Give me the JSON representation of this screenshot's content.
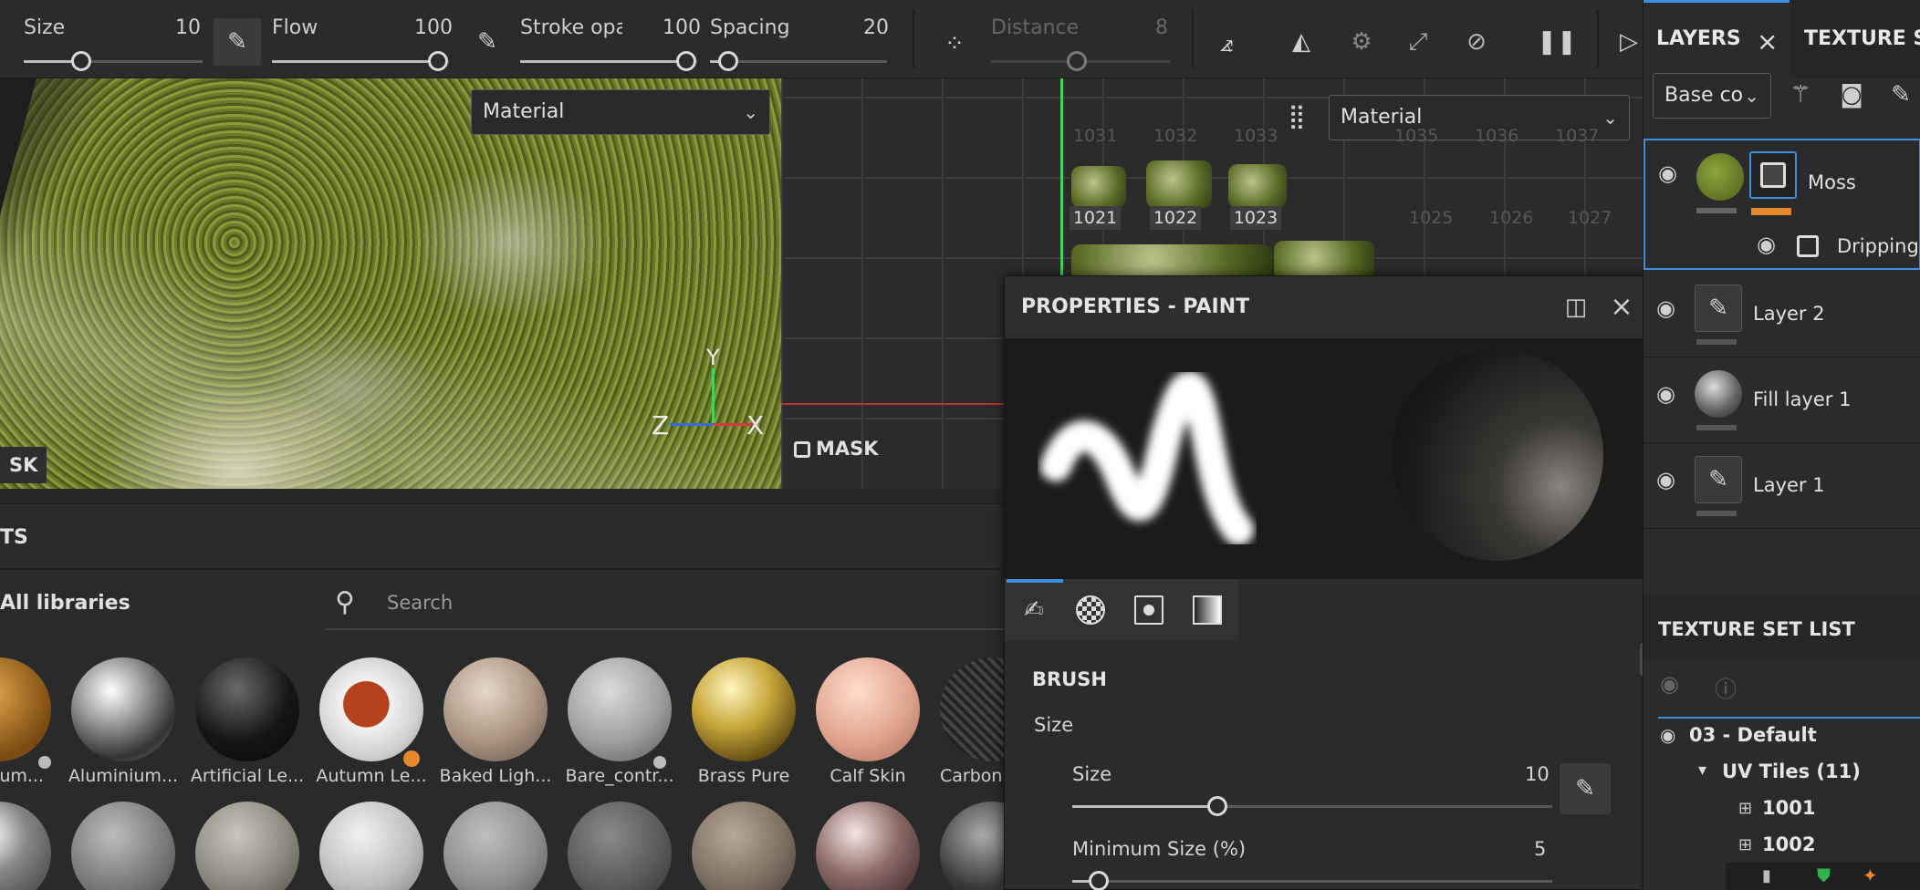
{
  "toolbar": {
    "size_label": "Size",
    "size_value": "10",
    "flow_label": "Flow",
    "flow_value": "100",
    "stroke_label": "Stroke opac",
    "stroke_value": "100",
    "spacing_label": "Spacing",
    "spacing_value": "20",
    "distance_label": "Distance",
    "distance_value": "8"
  },
  "viewport3d": {
    "material_select": "Material",
    "mask_label": "SK",
    "axis_y": "Y",
    "axis_z": "Z",
    "axis_x": "X"
  },
  "viewportUV": {
    "material_select": "Material",
    "mask_label": "MASK",
    "tiles_top": [
      "1031",
      "1032",
      "1033",
      "1034",
      "1035",
      "1036",
      "1037"
    ],
    "tiles_active": [
      "1021",
      "1022",
      "1023"
    ],
    "tiles_bottom": [
      "1025",
      "1026",
      "1027"
    ]
  },
  "assets": {
    "header": "TS",
    "library": "All libraries",
    "search_placeholder": "Search",
    "items": [
      "nium...",
      "Aluminium...",
      "Artificial Le...",
      "Autumn Le...",
      "Baked Ligh...",
      "Bare_contr...",
      "Brass Pure",
      "Calf Skin",
      "Carbon"
    ]
  },
  "properties": {
    "title": "PROPERTIES - PAINT",
    "brush_section": "BRUSH",
    "size_group": "Size",
    "size_label": "Size",
    "size_value": "10",
    "min_size_label": "Minimum Size (%)",
    "min_size_value": "5"
  },
  "layers": {
    "tab_layers": "LAYERS",
    "tab_texture": "TEXTURE SE",
    "channel_select": "Base co",
    "items": [
      {
        "name": "Moss"
      },
      {
        "name": "Dripping ..."
      },
      {
        "name": "Layer 2"
      },
      {
        "name": "Fill layer 1"
      },
      {
        "name": "Layer 1"
      }
    ],
    "texture_set_title": "TEXTURE SET LIST",
    "set_name": "03 - Default",
    "uv_tiles": "UV Tiles (11)",
    "tiles": [
      "1001",
      "1002"
    ]
  },
  "colors": {
    "accent": "#3d8fe0",
    "orange": "#e6892e",
    "uv_green": "#3bd65a",
    "uv_red": "#d53a3a"
  }
}
